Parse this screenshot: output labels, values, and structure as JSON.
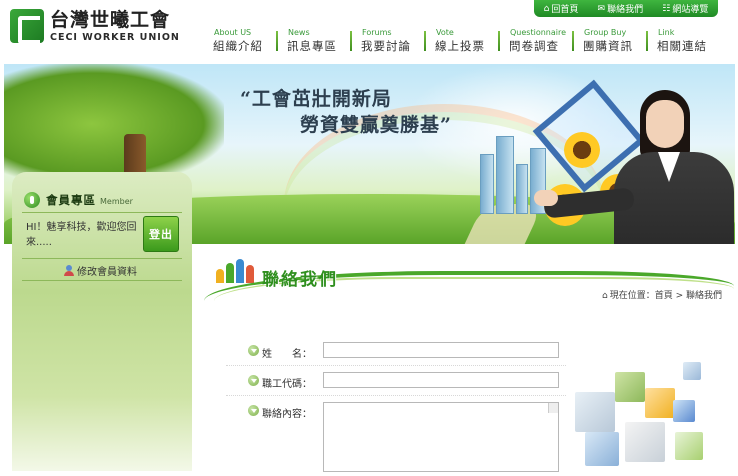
{
  "brand": {
    "name_cn": "台灣世曦工會",
    "name_en": "CECI WORKER UNION"
  },
  "top_links": [
    {
      "icon": "home-icon",
      "label": "回首頁"
    },
    {
      "icon": "mail-icon",
      "label": "聯絡我們"
    },
    {
      "icon": "sitemap-icon",
      "label": "網站導覽"
    }
  ],
  "nav": [
    {
      "en": "About US",
      "cn": "組織介紹"
    },
    {
      "en": "News",
      "cn": "訊息專區"
    },
    {
      "en": "Forums",
      "cn": "我要討論"
    },
    {
      "en": "Vote",
      "cn": "線上投票"
    },
    {
      "en": "Questionnaire",
      "cn": "問卷調查"
    },
    {
      "en": "Group Buy",
      "cn": "團購資訊"
    },
    {
      "en": "Link",
      "cn": "相關連結"
    }
  ],
  "banner": {
    "line1": "“工會茁壯開新局",
    "line2": "勞資雙贏奠勝基”"
  },
  "member": {
    "title": "會員專區",
    "title_en": "Member",
    "welcome": "HI！魅享科技，歡迎您回來.....",
    "logout": "登出",
    "edit_profile": "修改會員資料"
  },
  "section": {
    "title": "聯絡我們"
  },
  "breadcrumb": {
    "prefix": "現在位置：",
    "home": "首頁",
    "separator": ">",
    "current": "聯絡我們"
  },
  "form": {
    "name_label": "姓　　名：",
    "employee_id_label": "職工代碼：",
    "message_label": "聯絡內容：",
    "name_value": "",
    "employee_id_value": "",
    "message_value": ""
  },
  "colors": {
    "brand_green": "#2f8f1e",
    "nav_accent": "#3a9a3a",
    "sidebar_bg": "#bcd98e"
  }
}
